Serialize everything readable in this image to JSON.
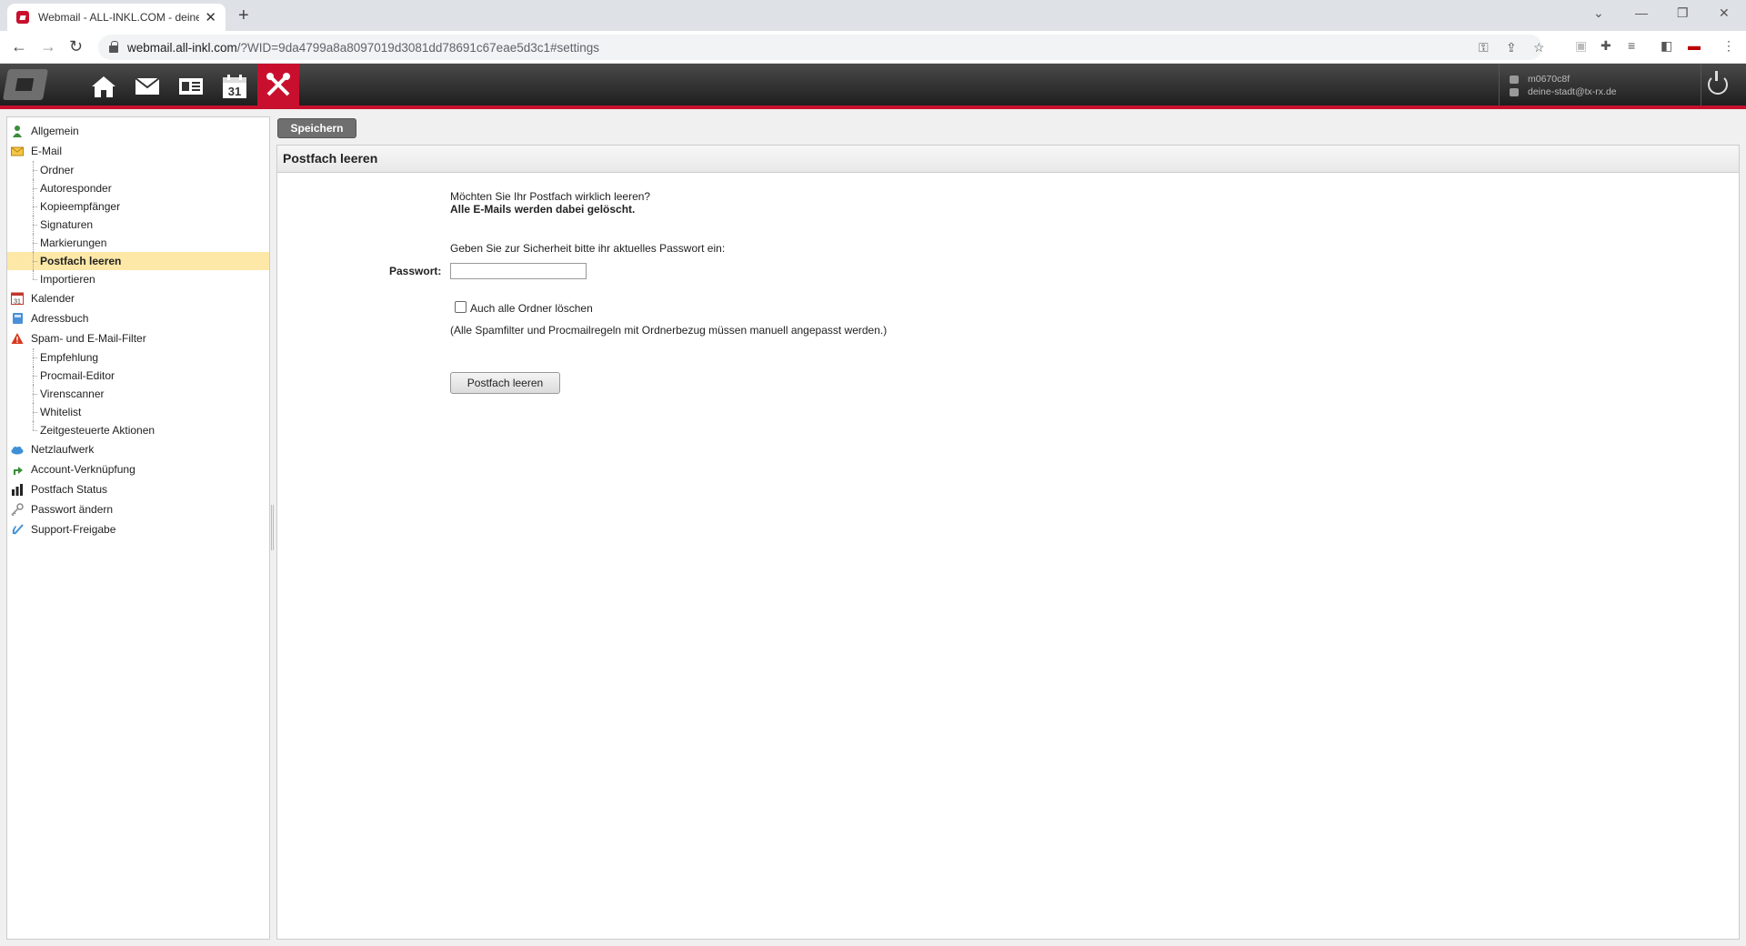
{
  "browser": {
    "tab_title": "Webmail - ALL-INKL.COM - deine",
    "url_host": "webmail.all-inkl.com",
    "url_rest": "/?WID=9da4799a8a8097019d3081dd78691c67eae5d3c1#settings"
  },
  "header": {
    "user_id": "m0670c8f",
    "user_email": "deine-stadt@tx-rx.de",
    "nav_icons": [
      "home-icon",
      "mail-icon",
      "contacts-icon",
      "calendar-icon",
      "settings-icon"
    ],
    "calendar_day": "31",
    "accent_color": "#c8102e"
  },
  "sidebar": {
    "allgemein": "Allgemein",
    "email": "E-Mail",
    "email_items": [
      "Ordner",
      "Autoresponder",
      "Kopieempfänger",
      "Signaturen",
      "Markierungen",
      "Postfach leeren",
      "Importieren"
    ],
    "active_item": "Postfach leeren",
    "kalender": "Kalender",
    "kalender_icon_day": "31",
    "adressbuch": "Adressbuch",
    "spam": "Spam- und E-Mail-Filter",
    "spam_items": [
      "Empfehlung",
      "Procmail-Editor",
      "Virenscanner",
      "Whitelist",
      "Zeitgesteuerte Aktionen"
    ],
    "netzlaufwerk": "Netzlaufwerk",
    "account": "Account-Verknüpfung",
    "status": "Postfach Status",
    "passwort": "Passwort ändern",
    "support": "Support-Freigabe"
  },
  "toolbar": {
    "save_label": "Speichern"
  },
  "main": {
    "title": "Postfach leeren",
    "question": "Möchten Sie Ihr Postfach wirklich leeren?",
    "warning": "Alle E-Mails werden dabei gelöscht.",
    "password_prompt": "Geben Sie zur Sicherheit bitte ihr aktuelles Passwort ein:",
    "password_label": "Passwort:",
    "password_value": "",
    "checkbox_label": "Auch alle Ordner löschen",
    "checkbox_checked": false,
    "note": "(Alle Spamfilter und Procmailregeln mit Ordnerbezug müssen manuell angepasst werden.)",
    "submit_label": "Postfach leeren"
  }
}
